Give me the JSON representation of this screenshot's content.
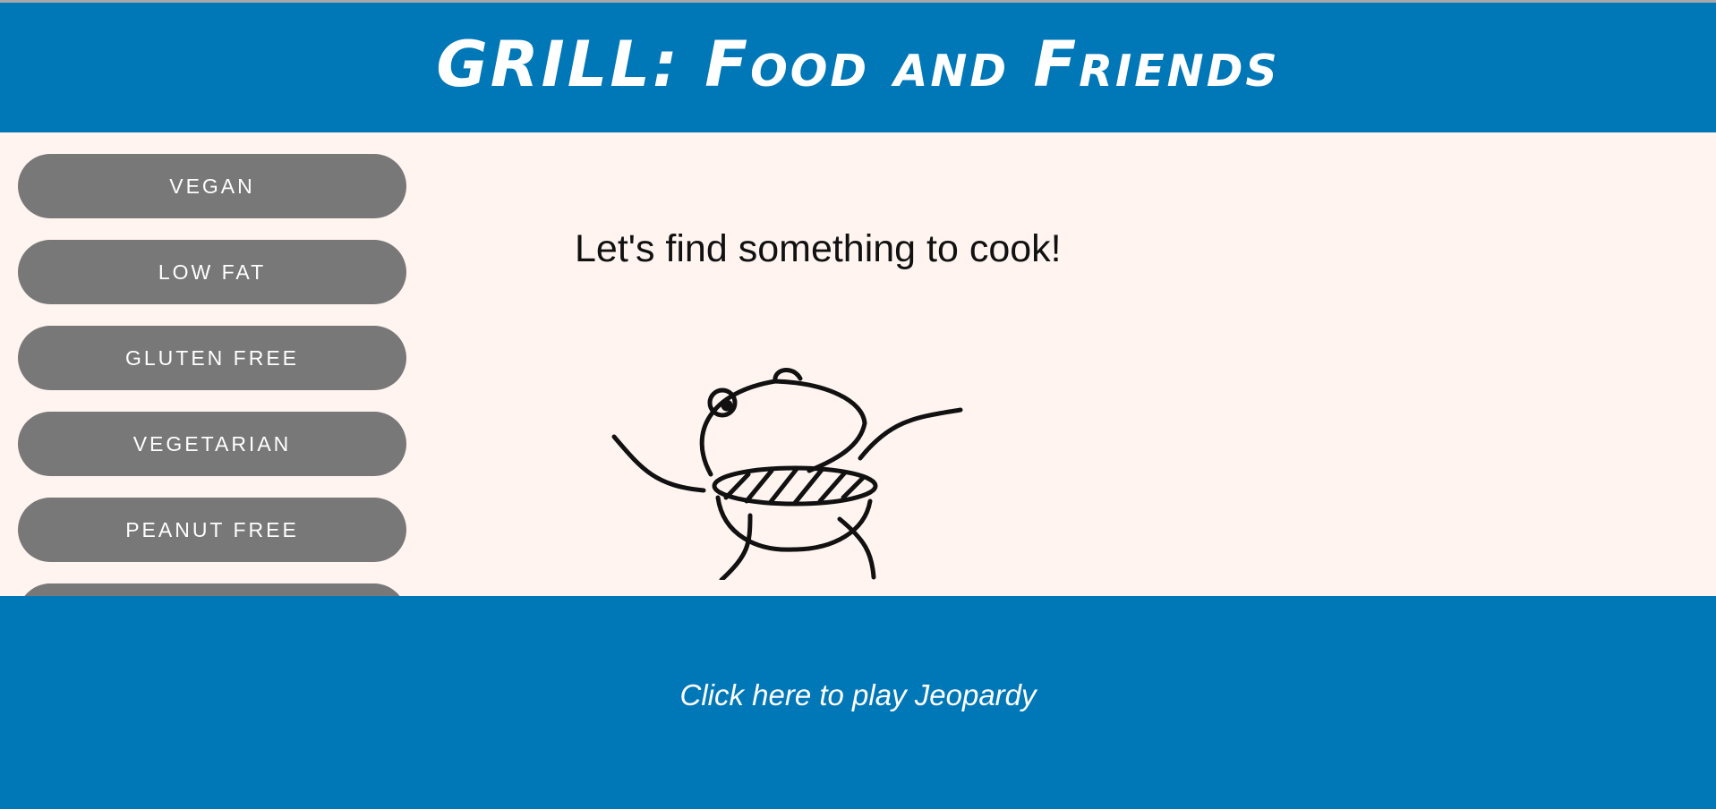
{
  "header": {
    "title": "GRILL: Food and Friends"
  },
  "sidebar": {
    "items": [
      {
        "label": "VEGAN"
      },
      {
        "label": "LOW FAT"
      },
      {
        "label": "GLUTEN FREE"
      },
      {
        "label": "VEGETARIAN"
      },
      {
        "label": "PEANUT FREE"
      },
      {
        "label": ""
      }
    ]
  },
  "main": {
    "heading": "Let's find something to cook!",
    "illustration_icon": "dancing-grill-icon"
  },
  "footer": {
    "link_label": "Click here to play Jeopardy"
  },
  "colors": {
    "header_bg": "#0077b6",
    "main_bg": "#fff4f0",
    "button_bg": "#787878",
    "text_light": "#ffffff",
    "text_dark": "#111111"
  }
}
